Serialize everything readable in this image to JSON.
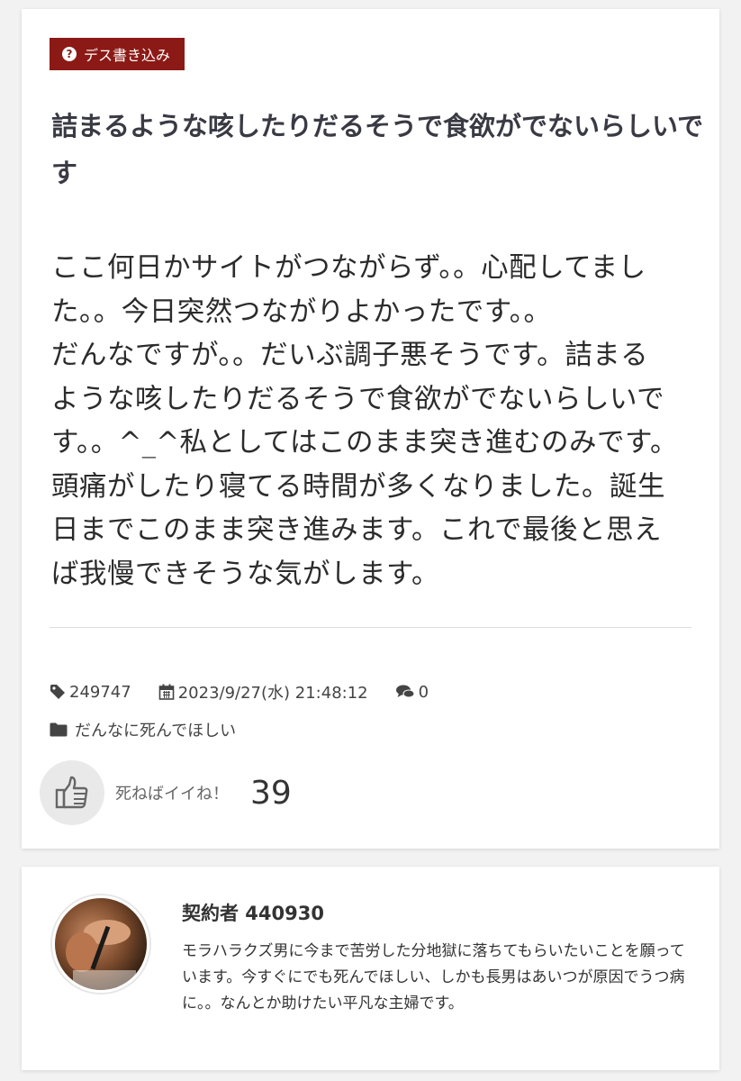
{
  "post": {
    "category_badge": "デス書き込み",
    "title": "詰まるような咳したりだるそうで食欲がでないらしいです",
    "body_lines": [
      "ここ何日かサイトがつながらず。。心配してまし",
      "た。。今日突然つながりよかったです。。",
      "だんなですが。。だいぶ調子悪そうです。詰まる",
      "ような咳したりだるそうで食欲がでないらしいで",
      "す。。^_^私としてはこのまま突き進むのみです。",
      "頭痛がしたり寝てる時間が多くなりました。誕生",
      "日までこのまま突き進みます。これで最後と思え",
      "ば我慢できそうな気がします。"
    ],
    "meta": {
      "id": "249747",
      "datetime": "2023/9/27(水) 21:48:12",
      "comments": "0",
      "category": "だんなに死んでほしい"
    },
    "like": {
      "label": "死ねばイイね！",
      "count": "39"
    }
  },
  "author": {
    "name": "契約者 440930",
    "bio": "モラハラクズ男に今まで苦労した分地獄に落ちてもらいたいことを願っています。今すぐにでも死んでほしい、しかも長男はあいつが原因でうつ病に。。なんとか助けたい平凡な主婦です。"
  },
  "colors": {
    "badge": "#8b1a16",
    "background": "#f2f2f2"
  }
}
